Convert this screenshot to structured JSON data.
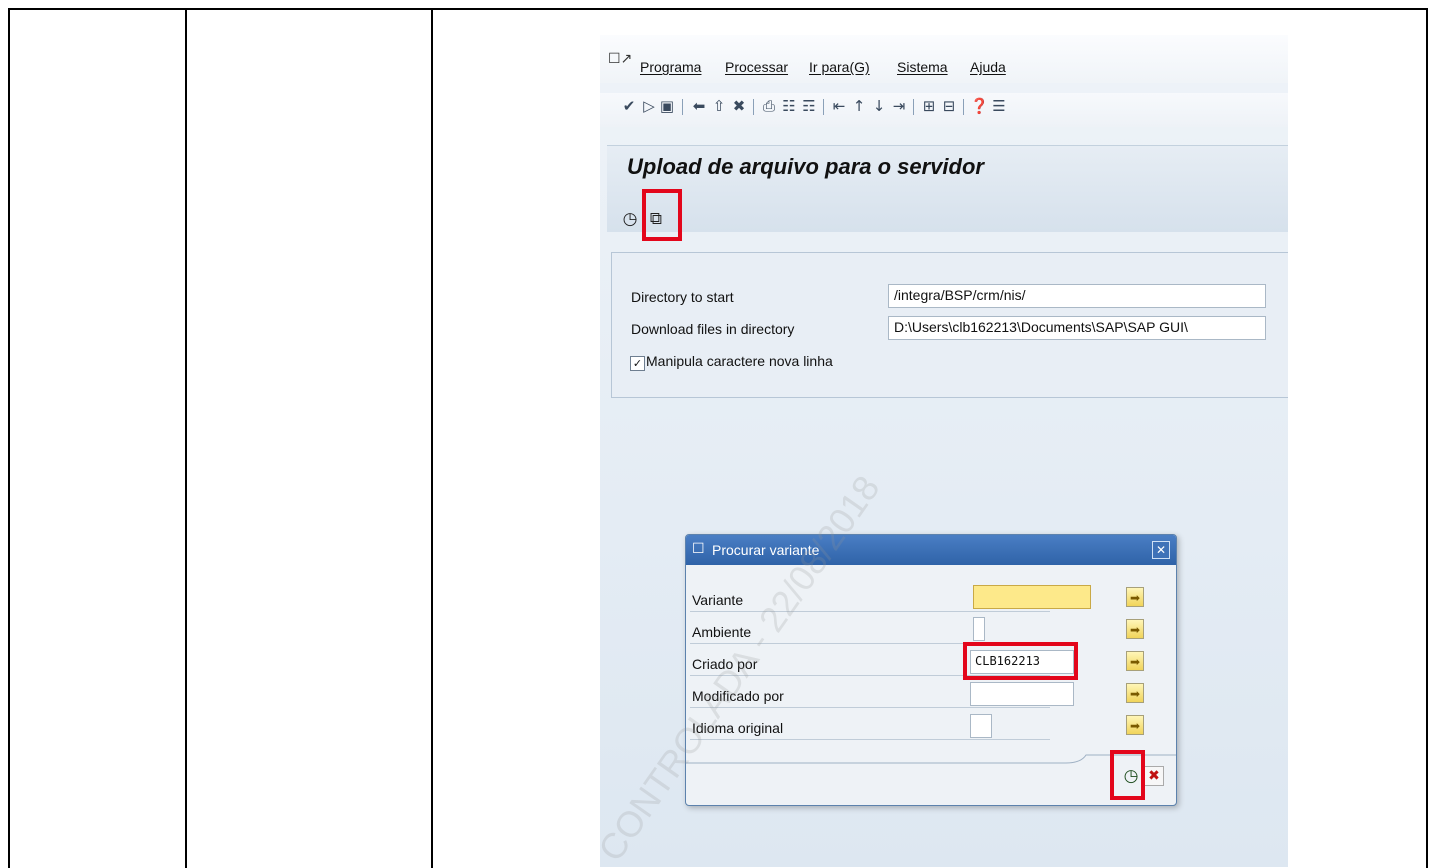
{
  "menubar": {
    "icon": "menu-window-icon",
    "items": [
      "Programa",
      "Processar",
      "Ir para(G)",
      "Sistema",
      "Ajuda"
    ]
  },
  "toolbar": {
    "icons": [
      "check-icon",
      "play-icon",
      "save-icon",
      "back-icon",
      "exit-icon",
      "cancel-icon",
      "print-icon",
      "find-icon",
      "find-next-icon",
      "first-page-icon",
      "prev-page-icon",
      "next-page-icon",
      "last-page-icon",
      "new-session-icon",
      "shortcut-icon",
      "help-icon",
      "customize-icon"
    ]
  },
  "screen": {
    "title": "Upload de arquivo para o servidor",
    "app_toolbar": [
      "execute-icon",
      "get-variant-icon"
    ]
  },
  "form": {
    "directory_label": "Directory to start",
    "directory_value": "/integra/BSP/crm/nis/",
    "download_label": "Download files in directory",
    "download_value": "D:\\Users\\clb162213\\Documents\\SAP\\SAP GUI\\",
    "checkbox_label": "Manipula caractere nova linha",
    "checkbox_checked": true
  },
  "dialog": {
    "title": "Procurar variante",
    "rows": [
      {
        "label": "Variante",
        "value": ""
      },
      {
        "label": "Ambiente",
        "value": ""
      },
      {
        "label": "Criado por",
        "value": "CLB162213"
      },
      {
        "label": "Modificado por",
        "value": ""
      },
      {
        "label": "Idioma original",
        "value": ""
      }
    ],
    "ok_icon": "execute-icon",
    "cancel_icon": "cancel-icon"
  },
  "watermark": "CONTROLADA - 22/08/2018",
  "colors": {
    "annotation_red": "#e3061b",
    "dialog_title_blue": "#2f63a8",
    "active_field_yellow": "#fde98a"
  }
}
